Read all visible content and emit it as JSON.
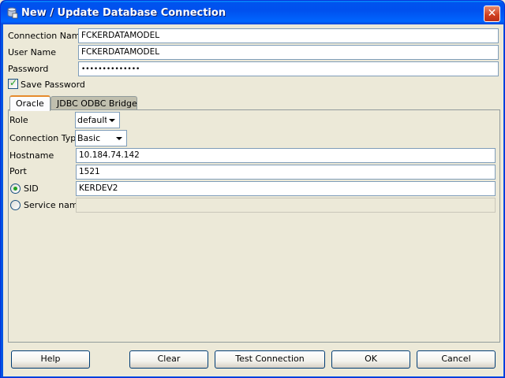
{
  "window": {
    "title": "New / Update Database Connection",
    "close_glyph": "✕"
  },
  "form": {
    "connection_name_label": "Connection Name",
    "connection_name_value": "FCKERDATAMODEL",
    "user_name_label": "User Name",
    "user_name_value": "FCKERDATAMODEL",
    "password_label": "Password",
    "password_value": "••••••••••••••",
    "save_password_label": "Save Password",
    "save_password_checked": true
  },
  "tabs": [
    {
      "label": "Oracle",
      "active": true
    },
    {
      "label": "JDBC ODBC Bridge",
      "active": false
    }
  ],
  "oracle": {
    "role_label": "Role",
    "role_value": "default",
    "connection_type_label": "Connection Type",
    "connection_type_value": "Basic",
    "hostname_label": "Hostname",
    "hostname_value": "10.184.74.142",
    "port_label": "Port",
    "port_value": "1521",
    "sid_label": "SID",
    "sid_value": "KERDEV2",
    "sid_selected": true,
    "service_name_label": "Service name",
    "service_name_value": ""
  },
  "buttons": {
    "help": "Help",
    "clear": "Clear",
    "test_connection": "Test Connection",
    "ok": "OK",
    "cancel": "Cancel"
  },
  "colors": {
    "titlebar": "#0054e3",
    "dialog_bg": "#ece9d8",
    "focus_tab": "#e68b2c"
  }
}
